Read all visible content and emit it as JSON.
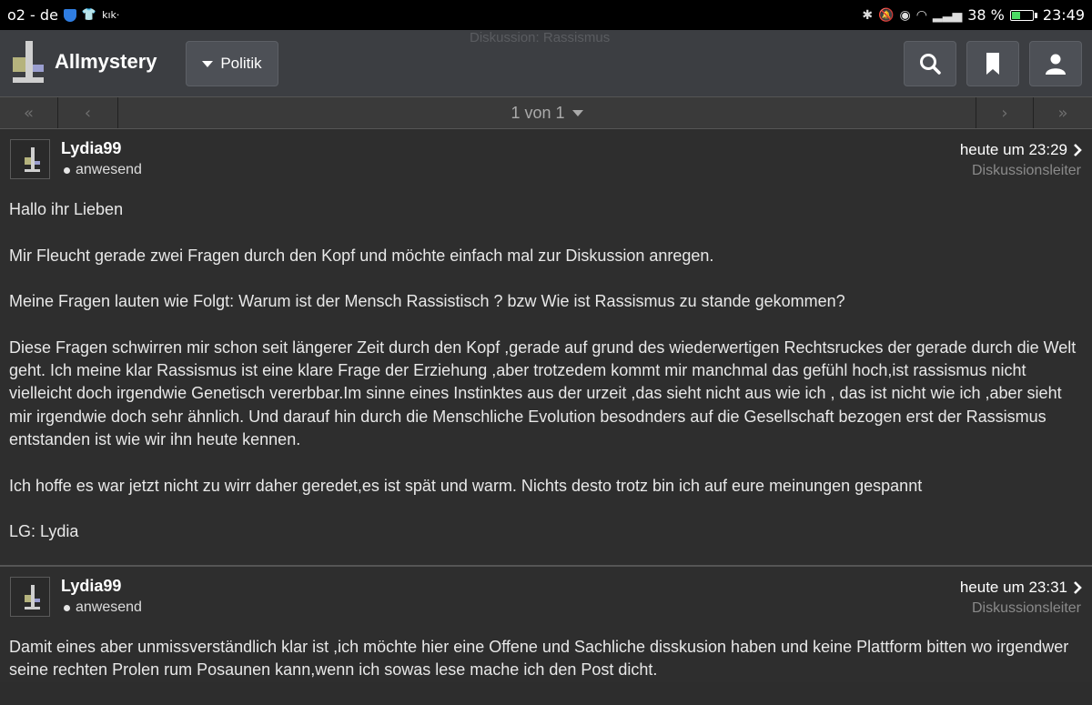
{
  "statusbar": {
    "carrier": "o2 - de",
    "app_badge": "kık·",
    "battery_percent": "38 %",
    "time": "23:49"
  },
  "header": {
    "brand": "Allmystery",
    "category": "Politik",
    "ghost_title": "Diskussion: Rassismus"
  },
  "pager": {
    "first": "«",
    "prev": "‹",
    "label": "1 von 1",
    "next": "›",
    "last": "»"
  },
  "posts": [
    {
      "user": "Lydia99",
      "status": "anwesend",
      "time": "heute um 23:29",
      "role": "Diskussionsleiter",
      "paragraphs": [
        "Hallo ihr Lieben",
        "Mir Fleucht gerade zwei Fragen durch den Kopf und möchte einfach mal zur Diskussion anregen.",
        "Meine Fragen lauten wie Folgt: Warum ist der Mensch Rassistisch ? bzw Wie ist Rassismus zu stande gekommen?",
        "Diese Fragen schwirren mir schon seit längerer Zeit durch den Kopf ,gerade auf grund des wiederwertigen Rechtsruckes der gerade durch die Welt geht. Ich meine klar Rassismus ist eine klare Frage der Erziehung ,aber trotzedem kommt mir manchmal das gefühl hoch,ist rassismus nicht vielleicht doch irgendwie Genetisch vererbbar.Im sinne eines Instinktes aus der urzeit ,das sieht nicht aus wie ich , das ist nicht wie ich ,aber sieht mir irgendwie doch sehr ähnlich. Und darauf hin durch die Menschliche Evolution besodnders auf die Gesellschaft bezogen erst der Rassismus entstanden ist wie wir ihn heute kennen.",
        "Ich hoffe es war jetzt nicht zu wirr daher geredet,es ist spät und warm. Nichts desto trotz bin ich auf eure meinungen gespannt",
        "LG: Lydia"
      ]
    },
    {
      "user": "Lydia99",
      "status": "anwesend",
      "time": "heute um 23:31",
      "role": "Diskussionsleiter",
      "paragraphs": [
        "Damit eines aber unmissverständlich klar ist ,ich möchte hier eine Offene und Sachliche disskusion haben und keine Plattform bitten wo irgendwer seine rechten Prolen rum Posaunen kann,wenn ich sowas lese mache ich den Post dicht."
      ]
    }
  ]
}
